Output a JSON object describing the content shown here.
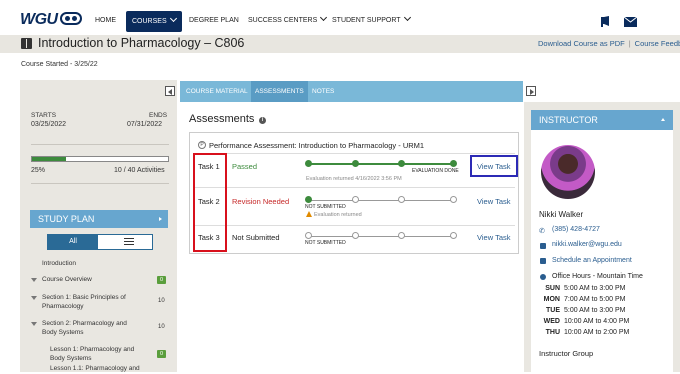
{
  "nav": {
    "logo": "WGU",
    "items": [
      "HOME",
      "COURSES",
      "DEGREE PLAN",
      "SUCCESS CENTERS",
      "STUDENT SUPPORT"
    ]
  },
  "title": {
    "course": "Introduction to Pharmacology – C806",
    "download_link": "Download Course as PDF",
    "feedback_link": "Course Feedba",
    "started": "Course Started - 3/25/22"
  },
  "left": {
    "starts_label": "STARTS",
    "starts_date": "03/25/2022",
    "ends_label": "ENDS",
    "ends_date": "07/31/2022",
    "progress_percent": 25,
    "progress_text": "25%",
    "activities_text": "10 / 40 Activities",
    "study_plan": "STUDY PLAN",
    "toggle_all": "All",
    "items": [
      {
        "label": "Introduction"
      },
      {
        "label": "Course Overview",
        "count": "0"
      },
      {
        "label": "Section 1: Basic Principles of Pharmacology",
        "count": "10"
      },
      {
        "label": "Section 2: Pharmacology and Body Systems",
        "count": "10"
      },
      {
        "label": "Lesson 1: Pharmacology and Body Systems",
        "count": "0"
      },
      {
        "label": "Lesson 1.1: Pharmacology and"
      }
    ]
  },
  "center": {
    "tabs": [
      "COURSE MATERIAL",
      "ASSESSMENTS",
      "NOTES"
    ],
    "heading": "Assessments",
    "assessment_title": "Performance Assessment: Introduction to Pharmacology - URM1",
    "tasks": [
      {
        "name": "Task 1",
        "status": "Passed",
        "status_color": "#3d8b3d",
        "note": "Evaluation returned 4/16/2022 3:56 PM",
        "progress_label": "EVALUATION DONE",
        "action": "View Task"
      },
      {
        "name": "Task 2",
        "status": "Revision Needed",
        "status_color": "#c62828",
        "note": "Evaluation returned",
        "progress_label": "NOT SUBMITTED",
        "action": "View Task"
      },
      {
        "name": "Task 3",
        "status": "Not Submitted",
        "status_color": "#222222",
        "progress_label": "NOT SUBMITTED",
        "action": "View Task"
      }
    ]
  },
  "instructor": {
    "heading": "INSTRUCTOR",
    "name": "Nikki Walker",
    "phone": "(385) 428-4727",
    "email": "nikki.walker@wgu.edu",
    "schedule": "Schedule an Appointment",
    "office_hours_label": "Office Hours - Mountain Time",
    "hours": [
      {
        "day": "SUN",
        "time": "5:00 AM to 3:00 PM"
      },
      {
        "day": "MON",
        "time": "7:00 AM to 5:00 PM"
      },
      {
        "day": "TUE",
        "time": "5:00 AM to 3:00 PM"
      },
      {
        "day": "WED",
        "time": "10:00 AM to 4:00 PM"
      },
      {
        "day": "THU",
        "time": "10:00 AM to 2:00 PM"
      }
    ],
    "group_label": "Instructor Group"
  },
  "colors": {
    "navy": "#0a2b5c",
    "accent": "#67a6cf",
    "highlight_red": "#d8101c",
    "highlight_blue": "#2c2ab5"
  }
}
